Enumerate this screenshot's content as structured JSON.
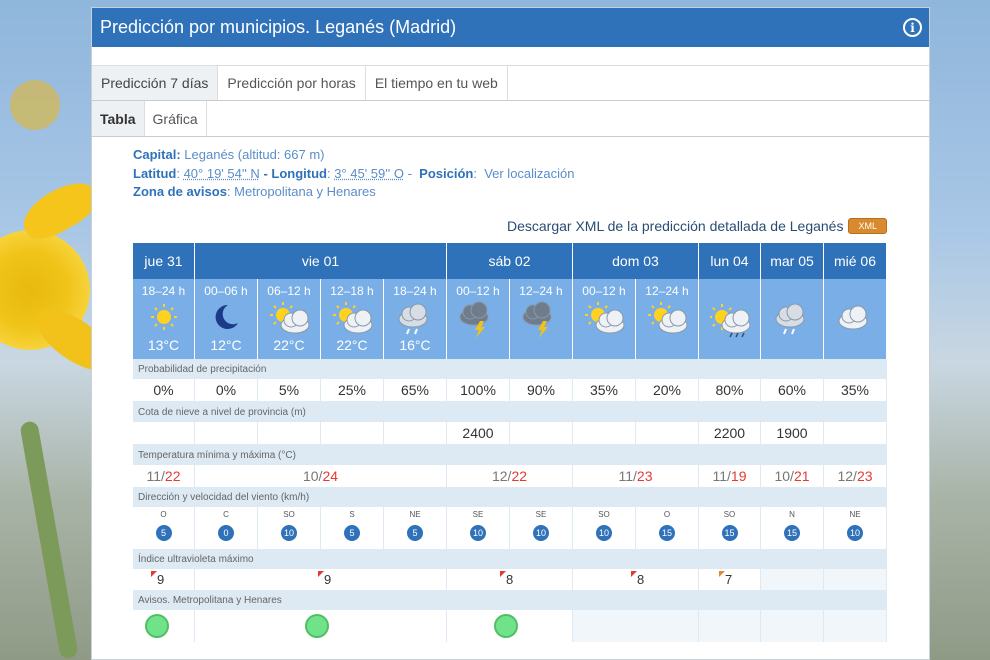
{
  "header": {
    "title": "Predicción por municipios. Leganés (Madrid)"
  },
  "tabs": [
    "Predicción 7 días",
    "Predicción por horas",
    "El tiempo en tu web"
  ],
  "subtabs": [
    "Tabla",
    "Gráfica"
  ],
  "meta": {
    "capital_label": "Capital:",
    "capital_value": "Leganés (altitud: 667 m)",
    "lat_label": "Latitud",
    "lat_value": "40° 19' 54'' N",
    "lon_label": "- Longitud",
    "lon_value": "3° 45' 59'' O",
    "pos_sep": "-",
    "pos_label": "Posición",
    "pos_link": "Ver localización",
    "zone_label": "Zona de avisos",
    "zone_value": "Metropolitana y Henares"
  },
  "download": {
    "text": "Descargar XML de la predicción detallada de Leganés",
    "badge": "XML"
  },
  "days": [
    {
      "label": "jue 31",
      "periods": [
        {
          "p": "18–24 h",
          "t": "13°C",
          "icon": "sun"
        }
      ]
    },
    {
      "label": "vie 01",
      "periods": [
        {
          "p": "00–06 h",
          "t": "12°C",
          "icon": "moon"
        },
        {
          "p": "06–12 h",
          "t": "22°C",
          "icon": "sun-cloud"
        },
        {
          "p": "12–18 h",
          "t": "22°C",
          "icon": "sun-cloud"
        },
        {
          "p": "18–24 h",
          "t": "16°C",
          "icon": "cloud-rain"
        }
      ]
    },
    {
      "label": "sáb 02",
      "periods": [
        {
          "p": "00–12 h",
          "t": "",
          "icon": "storm"
        },
        {
          "p": "12–24 h",
          "t": "",
          "icon": "storm"
        }
      ]
    },
    {
      "label": "dom 03",
      "periods": [
        {
          "p": "00–12 h",
          "t": "",
          "icon": "sun-cloud"
        },
        {
          "p": "12–24 h",
          "t": "",
          "icon": "sun-cloud"
        }
      ]
    },
    {
      "label": "lun 04",
      "periods": [
        {
          "p": "",
          "t": "",
          "icon": "sun-rain"
        }
      ]
    },
    {
      "label": "mar 05",
      "periods": [
        {
          "p": "",
          "t": "",
          "icon": "cloud-rain"
        }
      ]
    },
    {
      "label": "mié 06",
      "periods": [
        {
          "p": "",
          "t": "",
          "icon": "cloud"
        }
      ]
    }
  ],
  "sections": {
    "precip": "Probabilidad de precipitación",
    "snow": "Cota de nieve a nivel de provincia (m)",
    "temp": "Temperatura mínima y máxima (°C)",
    "wind": "Dirección y velocidad del viento (km/h)",
    "uv": "Índice ultravioleta máximo",
    "alerts": "Avisos. Metropolitana y Henares"
  },
  "precip": [
    "0%",
    "0%",
    "5%",
    "25%",
    "65%",
    "100%",
    "90%",
    "35%",
    "20%",
    "80%",
    "60%",
    "35%"
  ],
  "snow": [
    "",
    "",
    "",
    "",
    "",
    "2400",
    "",
    "",
    "",
    "2200",
    "1900",
    ""
  ],
  "temps": [
    {
      "min": "11",
      "max": "22"
    },
    {
      "min": "10",
      "max": "24"
    },
    {
      "min": "12",
      "max": "22"
    },
    {
      "min": "11",
      "max": "23"
    },
    {
      "min": "11",
      "max": "19"
    },
    {
      "min": "10",
      "max": "21"
    },
    {
      "min": "12",
      "max": "23"
    }
  ],
  "temp_sep": " / ",
  "wind": [
    {
      "d": "O",
      "s": "5"
    },
    {
      "d": "C",
      "s": "0"
    },
    {
      "d": "SO",
      "s": "10"
    },
    {
      "d": "S",
      "s": "5"
    },
    {
      "d": "NE",
      "s": "5"
    },
    {
      "d": "SE",
      "s": "10"
    },
    {
      "d": "SE",
      "s": "10"
    },
    {
      "d": "SO",
      "s": "10"
    },
    {
      "d": "O",
      "s": "15"
    },
    {
      "d": "SO",
      "s": "15"
    },
    {
      "d": "N",
      "s": "15"
    },
    {
      "d": "NE",
      "s": "10"
    }
  ],
  "uv": [
    {
      "v": "9",
      "color": "#e53935"
    },
    {
      "v": "9",
      "color": "#e53935"
    },
    {
      "v": "8",
      "color": "#e53935"
    },
    {
      "v": "8",
      "color": "#e53935"
    },
    {
      "v": "7",
      "color": "#e8862e"
    },
    {
      "v": "",
      "color": ""
    },
    {
      "v": "",
      "color": ""
    }
  ],
  "alert_color": "#6fe28a"
}
